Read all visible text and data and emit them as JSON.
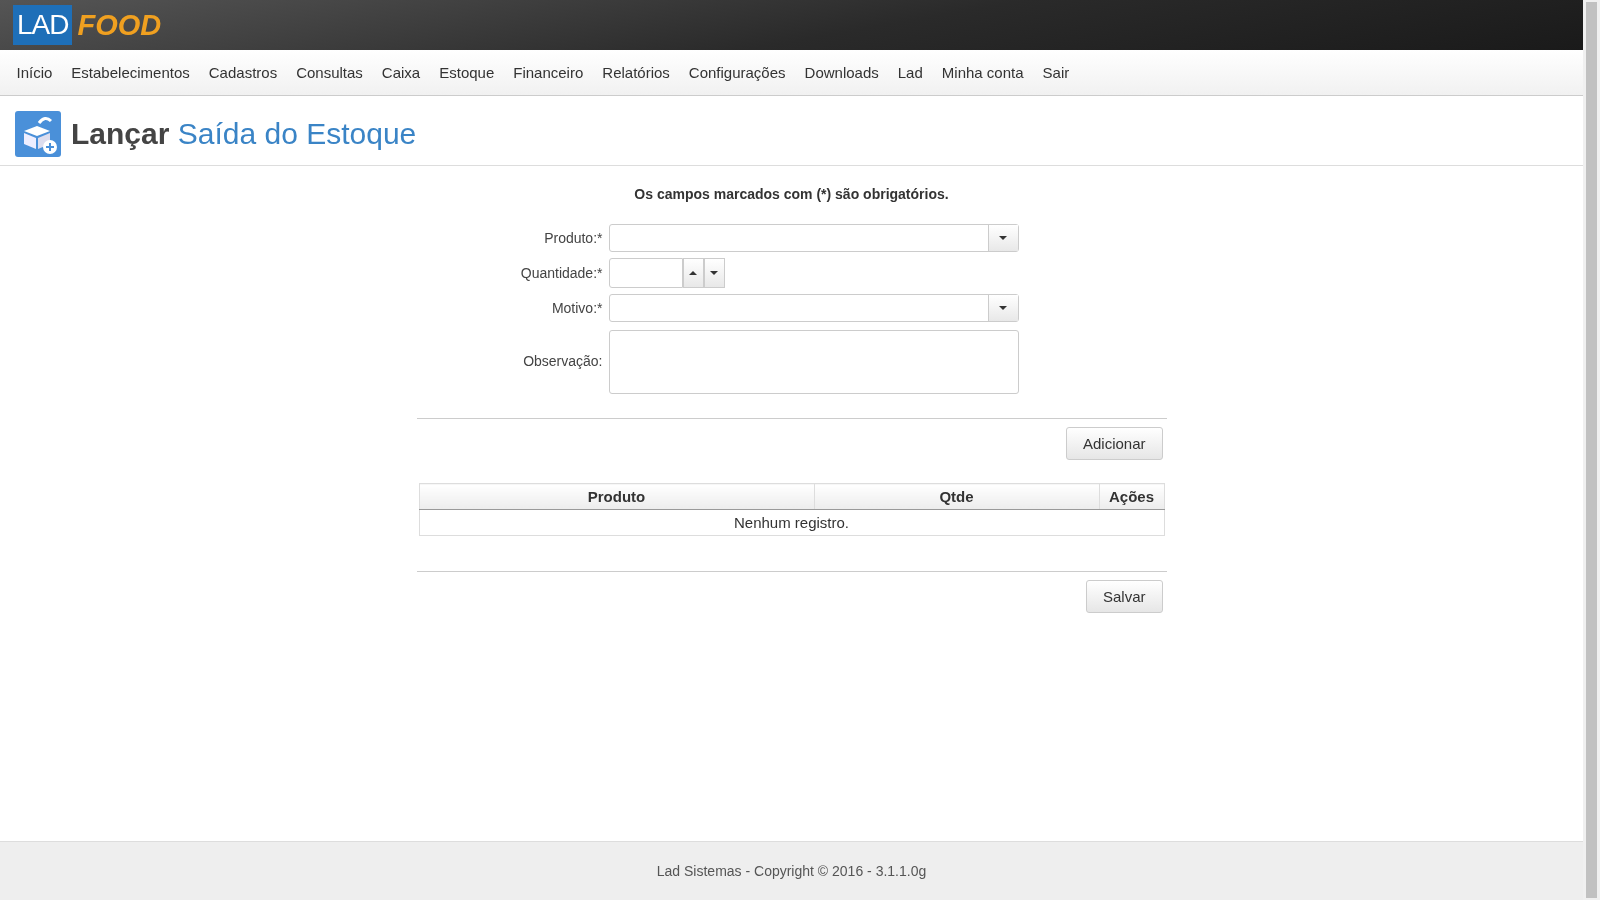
{
  "logo": {
    "part_1": "LAD",
    "part_2": "FOOD"
  },
  "nav": [
    "Início",
    "Estabelecimentos",
    "Cadastros",
    "Consultas",
    "Caixa",
    "Estoque",
    "Financeiro",
    "Relatórios",
    "Configurações",
    "Downloads",
    "Lad",
    "Minha conta",
    "Sair"
  ],
  "page_title": {
    "verb": "Lançar",
    "subject": "Saída do Estoque"
  },
  "required_note": "Os campos marcados com (*) são obrigatórios.",
  "fields": [
    {
      "label": "Produto:*",
      "kind": "select"
    },
    {
      "label": "Quantidade:*",
      "kind": "spinner"
    },
    {
      "label": "Motivo:*",
      "kind": "select"
    },
    {
      "label": "Observação:",
      "kind": "textarea"
    }
  ],
  "add_button": "Adicionar",
  "table": {
    "columns": [
      "Produto",
      "Qtde",
      "Ações"
    ],
    "empty_message": "Nenhum registro."
  },
  "save_button": "Salvar",
  "footer": "Lad Sistemas - Copyright © 2016 - 3.1.1.0g"
}
